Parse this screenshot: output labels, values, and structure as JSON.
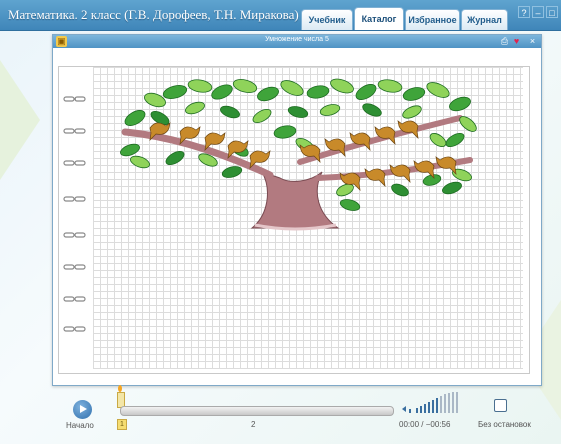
{
  "app": {
    "title": "Математика. 2 класс (Г.В. Дорофеев, Т.Н. Миракова)",
    "tabs": [
      {
        "label": "Учебник",
        "active": false
      },
      {
        "label": "Каталог",
        "active": true
      },
      {
        "label": "Избранное",
        "active": false
      },
      {
        "label": "Журнал",
        "active": false
      }
    ],
    "window_buttons": [
      "?",
      "–",
      "□"
    ]
  },
  "panel": {
    "title": "Умножение числа 5",
    "icons": [
      "print-icon",
      "heart-icon",
      "close-icon"
    ],
    "accent_color": "#4f93c4"
  },
  "scene": {
    "description_icons": [
      "tree-icon",
      "bird-icon"
    ],
    "birds_left_branch": 5,
    "birds_right_branch_upper": 5,
    "birds_right_branch_lower": 5
  },
  "player": {
    "start_label": "Начало",
    "position_label": "1",
    "slider_label": "2",
    "time_current": "00:00",
    "time_separator": "/",
    "time_remaining": "−00:56",
    "no_stop_label": "Без остановок",
    "no_stop_checked": false,
    "progress": 0.0
  }
}
